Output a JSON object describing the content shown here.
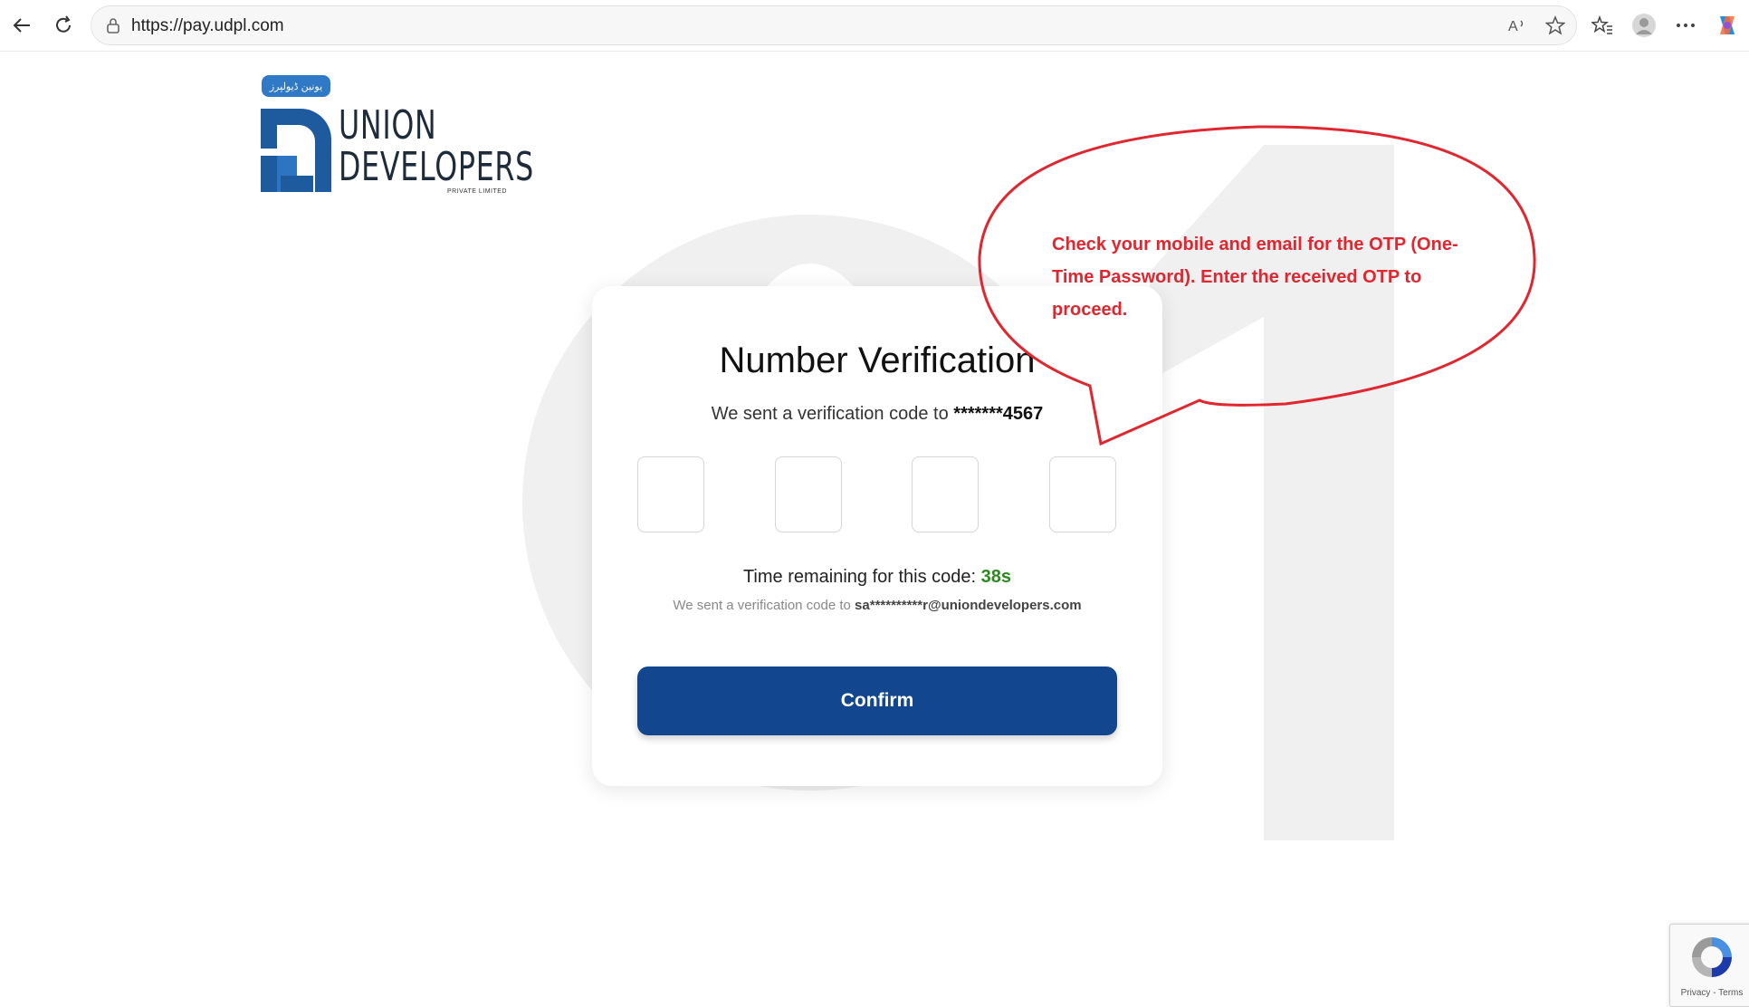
{
  "browser": {
    "url": "https://pay.udpl.com",
    "icons": {
      "back": "back-arrow-icon",
      "refresh": "refresh-icon",
      "lock": "lock-icon",
      "read_aloud": "read-aloud-icon",
      "favorite": "star-icon",
      "favorites": "favorites-icon",
      "profile": "profile-icon",
      "more": "more-icon",
      "copilot": "copilot-icon"
    }
  },
  "logo": {
    "badge_text": "یونین ڈیولپرز",
    "line1": "UNION",
    "line2": "DEVELOPERS",
    "sub": "PRIVATE LIMITED",
    "brand_color": "#1e5a9e"
  },
  "watermark": {
    "text": "01",
    "color": "#f0f0f0"
  },
  "verification": {
    "title": "Number Verification",
    "sent_prefix": "We sent a verification code to",
    "masked_phone": "*******4567",
    "otp_digits": [
      "",
      "",
      "",
      ""
    ],
    "timer_label": "Time remaining for this code:",
    "timer_value": "38s",
    "email_prefix": "We sent a verification code to",
    "masked_email": "sa**********r@uniondevelopers.com",
    "confirm_label": "Confirm",
    "button_color": "#12478f"
  },
  "callout": {
    "text": "Check your mobile and email for the OTP (One-Time Password). Enter the received OTP to proceed.",
    "color": "#e0262f"
  },
  "recaptcha": {
    "links": "Privacy - Terms"
  }
}
